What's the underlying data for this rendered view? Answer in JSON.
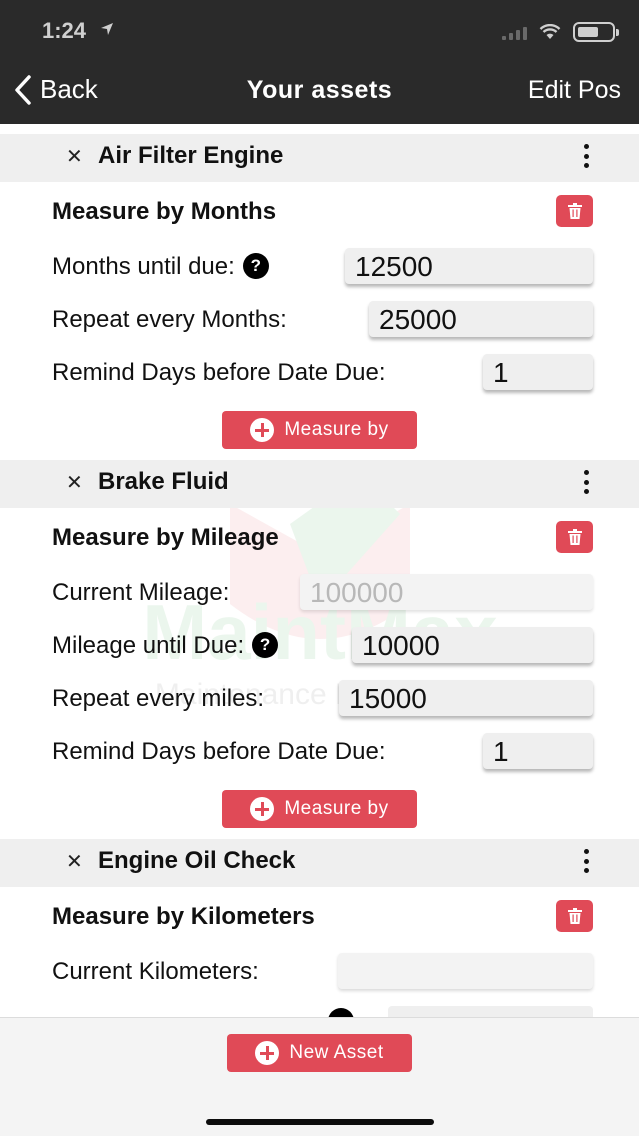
{
  "status_bar": {
    "time": "1:24"
  },
  "nav": {
    "back_label": "Back",
    "title": "Your assets",
    "edit_label": "Edit Pos"
  },
  "accent_color": "#e04a57",
  "assets": [
    {
      "name": "Air Filter Engine",
      "measure_title": "Measure by Months",
      "fields": [
        {
          "label": "Months until due:",
          "value": "12500",
          "help": true
        },
        {
          "label": "Repeat every Months:",
          "value": "25000"
        },
        {
          "label": "Remind Days before Date Due:",
          "value": "1"
        }
      ],
      "measure_button": "Measure by"
    },
    {
      "name": "Brake Fluid",
      "measure_title": "Measure by Mileage",
      "fields": [
        {
          "label": "Current Mileage:",
          "value": "",
          "placeholder": "100000"
        },
        {
          "label": "Mileage until Due:",
          "value": "10000",
          "help": true
        },
        {
          "label": "Repeat every miles:",
          "value": "15000"
        },
        {
          "label": "Remind Days before Date Due:",
          "value": "1"
        }
      ],
      "measure_button": "Measure by"
    },
    {
      "name": "Engine Oil Check",
      "measure_title": "Measure by Kilometers",
      "fields": [
        {
          "label": "Current Kilometers:",
          "value": ""
        }
      ]
    }
  ],
  "watermark": {
    "brand": "MaintMax",
    "tagline": "Maintenance Made Easy"
  },
  "footer": {
    "new_asset_label": "New Asset"
  },
  "icons": [
    "back-chevron-icon",
    "close-icon",
    "more-vertical-icon",
    "trash-icon",
    "help-icon",
    "plus-circle-icon",
    "wifi-icon",
    "battery-icon",
    "location-arrow-icon"
  ]
}
